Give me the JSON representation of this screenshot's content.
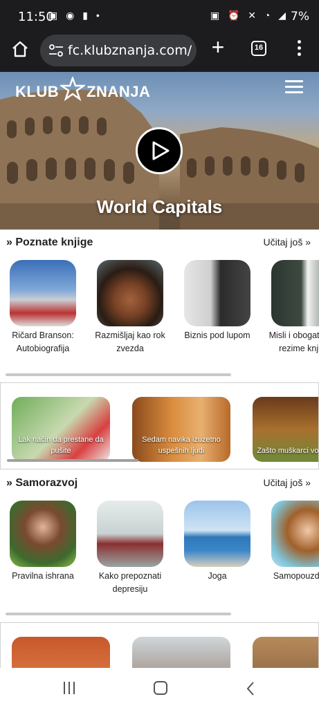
{
  "status": {
    "time": "11:50",
    "left_icons": [
      "gallery-icon",
      "viber-icon",
      "notification-icon",
      "dot-icon"
    ],
    "right_icons": [
      "screenshot-icon",
      "alarm-icon",
      "mute-icon",
      "wifi-icon",
      "signal-icon"
    ],
    "battery": "7%"
  },
  "browser": {
    "url": "fc.klubznanja.com/",
    "tab_count": "16"
  },
  "hero": {
    "logo_left": "KLUB",
    "logo_right": "ZNANJA",
    "title": "World Capitals"
  },
  "sections": [
    {
      "title": "» Poznate knjige",
      "more": "Učitaj još »",
      "items": [
        {
          "caption": "Ričard Branson: Autobiografija"
        },
        {
          "caption": "Razmišljaj kao rok zvezda"
        },
        {
          "caption": "Biznis pod lupom"
        },
        {
          "caption": "Misli i obogati se – rezime knjige"
        }
      ]
    },
    {
      "title": "» Samorazvoj",
      "more": "Učitaj još »",
      "items": [
        {
          "caption": "Pravilna ishrana"
        },
        {
          "caption": "Kako prepoznati depresiju"
        },
        {
          "caption": "Joga"
        },
        {
          "caption": "Samopouzdanje"
        }
      ]
    }
  ],
  "featured": [
    {
      "caption": "Lak način da prestane da pušite"
    },
    {
      "caption": "Sedam navika izuzetno uspešnih ljudi"
    },
    {
      "caption": "Zašto muškarci vole kučke"
    }
  ],
  "colors": {
    "browser_bar": "#1c1c1e",
    "url_pill": "#3a3b3f",
    "text": "#222222"
  }
}
